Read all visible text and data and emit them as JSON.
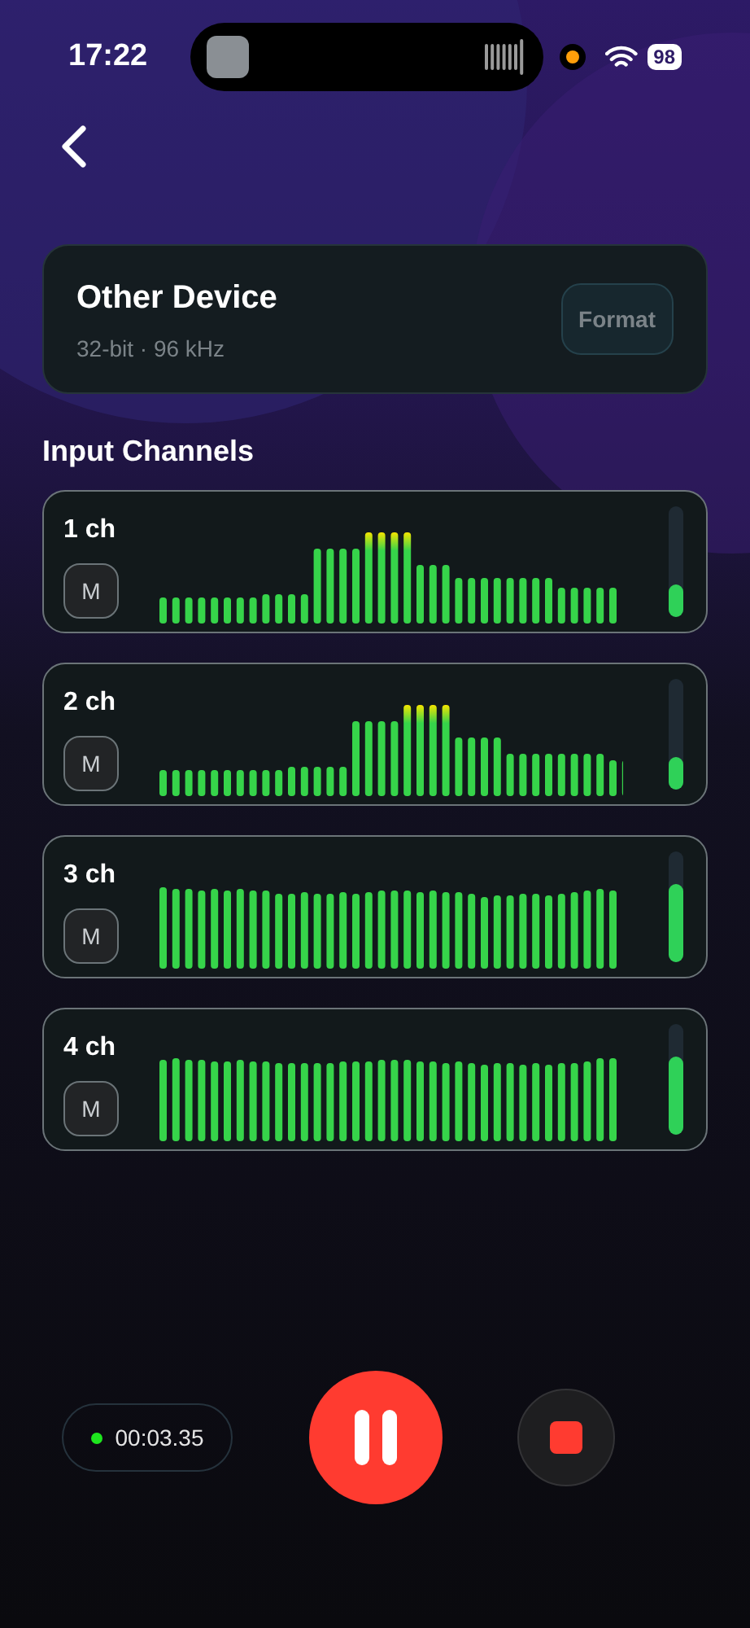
{
  "status_bar": {
    "time": "17:22",
    "battery": "98",
    "recording_dot": true
  },
  "device": {
    "name": "Other Device",
    "format_info": "32-bit · 96 kHz",
    "format_button": "Format"
  },
  "section_title": "Input Channels",
  "channels": [
    {
      "name": "1 ch",
      "mute_label": "M",
      "muted": false,
      "level": 0.3
    },
    {
      "name": "2 ch",
      "mute_label": "M",
      "muted": false,
      "level": 0.3
    },
    {
      "name": "3 ch",
      "mute_label": "M",
      "muted": false,
      "level": 0.7
    },
    {
      "name": "4 ch",
      "mute_label": "M",
      "muted": false,
      "level": 0.7
    }
  ],
  "recorder": {
    "elapsed": "00:03.35",
    "recording": true,
    "paused": false
  }
}
